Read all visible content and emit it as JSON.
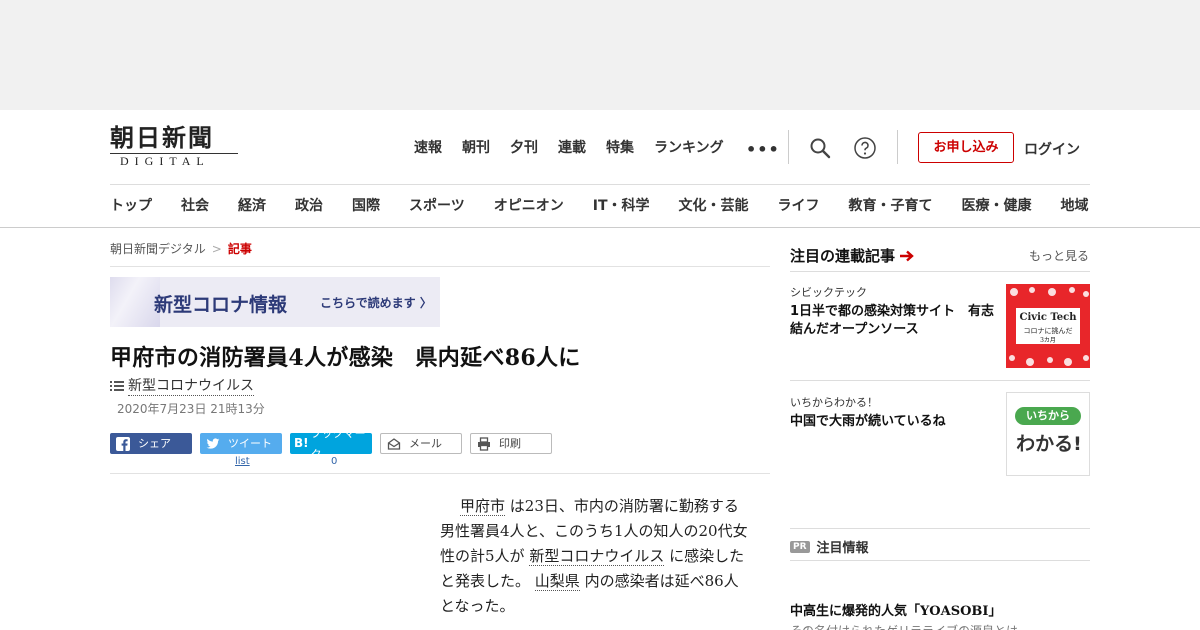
{
  "logo": {
    "kanji": "朝日新聞",
    "latin": "DIGITAL"
  },
  "topnav": [
    "速報",
    "朝刊",
    "夕刊",
    "連載",
    "特集",
    "ランキング"
  ],
  "more_dots": "•••",
  "header": {
    "apply_label": "お申し込み",
    "login_label": "ログイン"
  },
  "categories": [
    "トップ",
    "社会",
    "経済",
    "政治",
    "国際",
    "スポーツ",
    "オピニオン",
    "IT・科学",
    "文化・芸能",
    "ライフ",
    "教育・子育て",
    "医療・健康",
    "地域"
  ],
  "breadcrumb": {
    "home": "朝日新聞デジタル",
    "sep": ">",
    "current": "記事"
  },
  "banner": {
    "title": "新型コロナ情報",
    "link": "こちらで読めます"
  },
  "article": {
    "headline": "甲府市の消防署員4人が感染　県内延べ86人に",
    "tag": "新型コロナウイルス",
    "date": "2020年7月23日 21時13分",
    "body": {
      "p1": "甲府市",
      "p2": "は23日、市内の消防署に勤務する男性署員4人と、このうち1人の知人の20代女性の計5人が",
      "p3": "新型コロナウイルス",
      "p4": "に感染したと発表した。",
      "p5": "山梨県",
      "p6": "内の感染者は延べ86人となった。"
    }
  },
  "share": {
    "facebook": "シェア",
    "twitter": "ツイート",
    "hatena": "ブックマーク",
    "hatena_mark": "B!",
    "mail": "メール",
    "print": "印刷",
    "twitter_count": "list",
    "hatena_count": "0"
  },
  "sidebar": {
    "title": "注目の連載記事",
    "more": "もっと見る",
    "items": [
      {
        "series": "シビックテック",
        "title": "1日半で都の感染対策サイト　有志結んだオープンソース",
        "thumb_title": "Civic Tech",
        "thumb_sub": "コロナに挑んだ",
        "thumb_sub2": "3カ月"
      },
      {
        "series": "いちからわかる！",
        "title": "中国で大雨が続いているね",
        "thumb_top": "いちから",
        "thumb_bottom": "わかる!"
      }
    ],
    "pr_badge": "PR",
    "pr_label": "注目情報",
    "promo_title": "中高生に爆発的人気「YOASOBI」",
    "promo_sub": "その名付けられたゲリラライブの源泉とは"
  },
  "colors": {
    "accent_red": "#cc0000",
    "facebook": "#3b5998",
    "twitter": "#55acee",
    "hatena": "#00a4de",
    "banner_text": "#2d3a78"
  }
}
